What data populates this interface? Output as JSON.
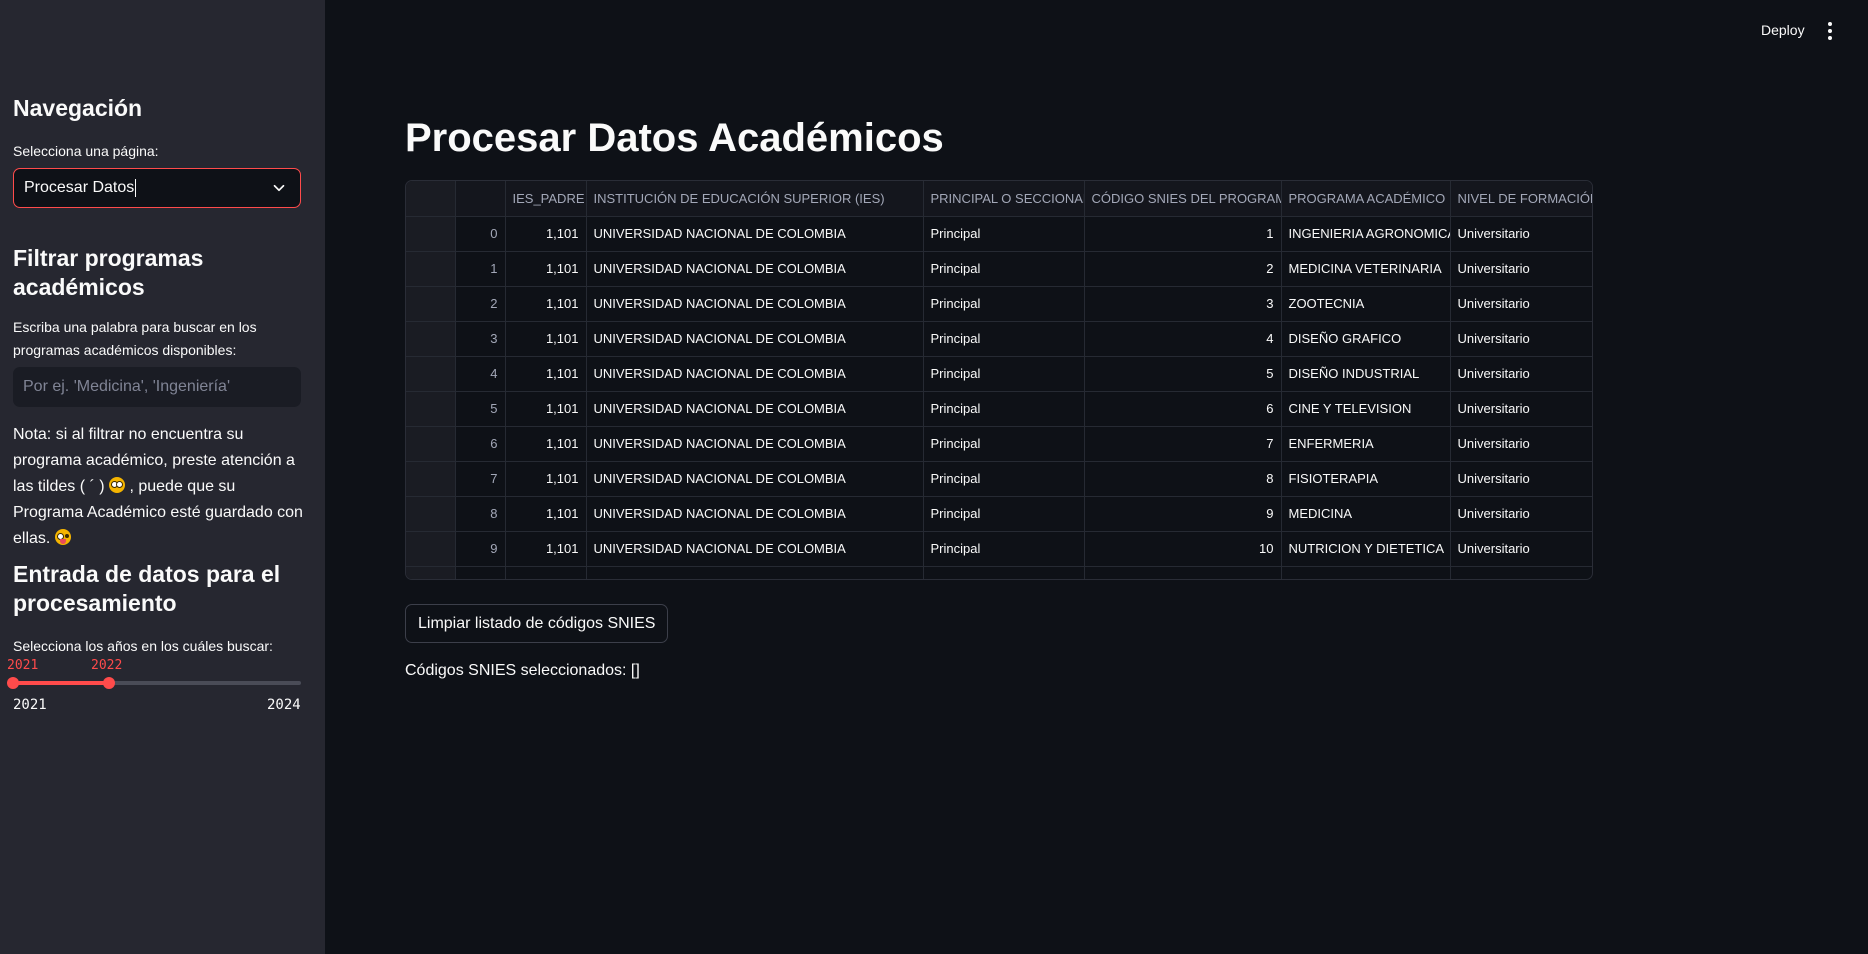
{
  "header": {
    "deploy_label": "Deploy",
    "menu_icon": "kebab-menu-icon"
  },
  "sidebar": {
    "nav_heading": "Navegación",
    "page_select_label": "Selecciona una página:",
    "page_select_value": "Procesar Datos",
    "filter_heading": "Filtrar programas académicos",
    "search_label": "Escriba una palabra para buscar en los programas académicos disponibles:",
    "search_placeholder": "Por ej. 'Medicina', 'Ingeniería'",
    "search_value": "",
    "note_part1": "Nota: si al filtrar no encuentra su programa académico, preste atención a las tildes ( ´ ) ",
    "note_part2": " , puede que su Programa Académico esté guardado con ellas. ",
    "input_heading": "Entrada de datos para el procesamiento",
    "years_label": "Selecciona los años en los cuáles buscar:",
    "slider": {
      "min": 2021,
      "max": 2024,
      "low": 2021,
      "high": 2022
    }
  },
  "main": {
    "title": "Procesar Datos Académicos",
    "table": {
      "columns": [
        "",
        "IES_PADRE",
        "INSTITUCIÓN DE EDUCACIÓN SUPERIOR (IES)",
        "PRINCIPAL O SECCIONAL",
        "CÓDIGO SNIES DEL PROGRAMA",
        "PROGRAMA ACADÉMICO",
        "NIVEL DE FORMACIÓN"
      ],
      "rows": [
        [
          "0",
          "1,101",
          "UNIVERSIDAD NACIONAL DE COLOMBIA",
          "Principal",
          "1",
          "INGENIERIA AGRONOMICA",
          "Universitario"
        ],
        [
          "1",
          "1,101",
          "UNIVERSIDAD NACIONAL DE COLOMBIA",
          "Principal",
          "2",
          "MEDICINA VETERINARIA",
          "Universitario"
        ],
        [
          "2",
          "1,101",
          "UNIVERSIDAD NACIONAL DE COLOMBIA",
          "Principal",
          "3",
          "ZOOTECNIA",
          "Universitario"
        ],
        [
          "3",
          "1,101",
          "UNIVERSIDAD NACIONAL DE COLOMBIA",
          "Principal",
          "4",
          "DISEÑO GRAFICO",
          "Universitario"
        ],
        [
          "4",
          "1,101",
          "UNIVERSIDAD NACIONAL DE COLOMBIA",
          "Principal",
          "5",
          "DISEÑO INDUSTRIAL",
          "Universitario"
        ],
        [
          "5",
          "1,101",
          "UNIVERSIDAD NACIONAL DE COLOMBIA",
          "Principal",
          "6",
          "CINE Y TELEVISION",
          "Universitario"
        ],
        [
          "6",
          "1,101",
          "UNIVERSIDAD NACIONAL DE COLOMBIA",
          "Principal",
          "7",
          "ENFERMERIA",
          "Universitario"
        ],
        [
          "7",
          "1,101",
          "UNIVERSIDAD NACIONAL DE COLOMBIA",
          "Principal",
          "8",
          "FISIOTERAPIA",
          "Universitario"
        ],
        [
          "8",
          "1,101",
          "UNIVERSIDAD NACIONAL DE COLOMBIA",
          "Principal",
          "9",
          "MEDICINA",
          "Universitario"
        ],
        [
          "9",
          "1,101",
          "UNIVERSIDAD NACIONAL DE COLOMBIA",
          "Principal",
          "10",
          "NUTRICION Y DIETETICA",
          "Universitario"
        ]
      ]
    },
    "clear_button_label": "Limpiar listado de códigos SNIES",
    "selected_codes_text": "Códigos SNIES seleccionados: []"
  },
  "colors": {
    "accent": "#ff4b4b",
    "sidebar_bg": "#262730",
    "main_bg": "#0e1117"
  }
}
